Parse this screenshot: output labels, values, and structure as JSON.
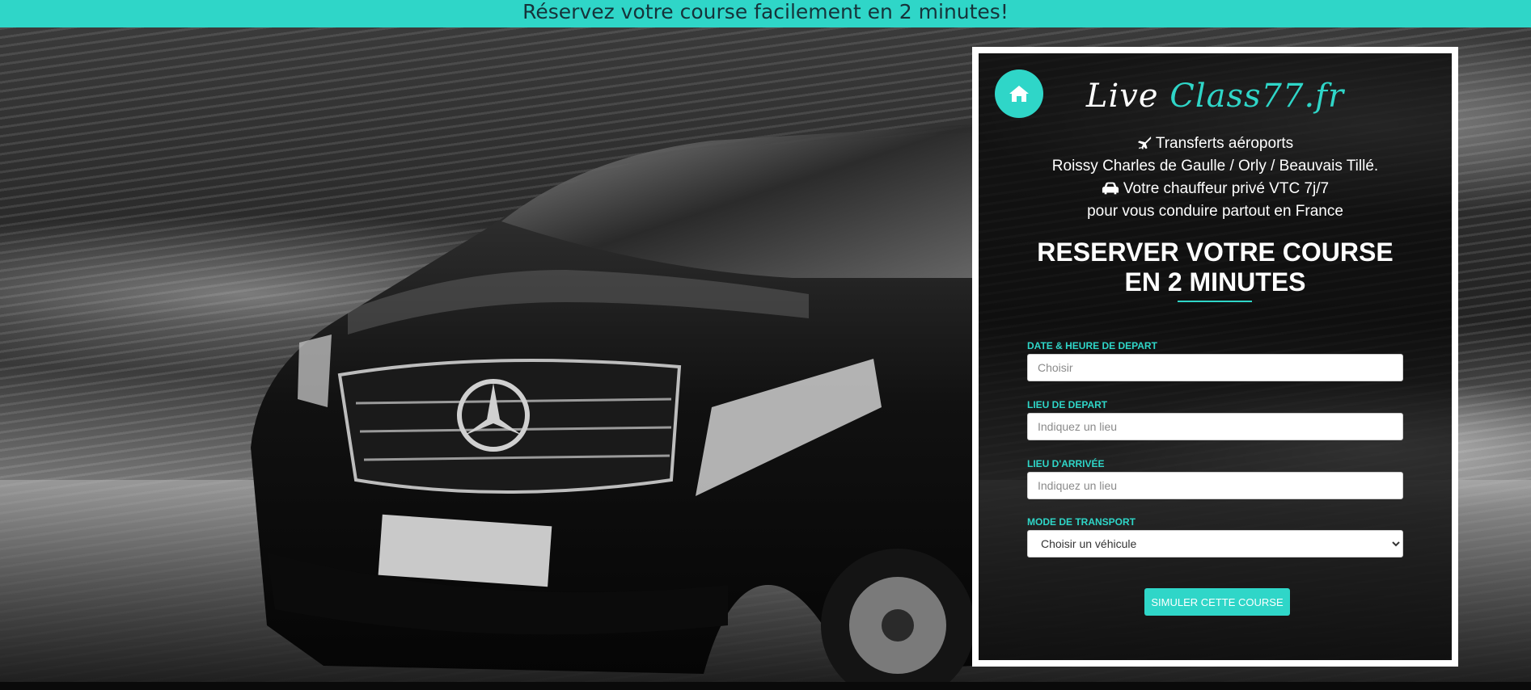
{
  "banner": {
    "text": "Réservez votre course facilement en 2 minutes!"
  },
  "brand": {
    "logo_part1": "Live",
    "logo_part2": "Class77.fr"
  },
  "intro": {
    "line1": "Transferts aéroports",
    "line2": "Roissy Charles de Gaulle / Orly / Beauvais Tillé.",
    "line3": "Votre chauffeur privé VTC 7j/7",
    "line4": "pour vous conduire partout en France"
  },
  "booking": {
    "heading_line1": "RESERVER VOTRE COURSE",
    "heading_line2": "EN 2 MINUTES",
    "fields": {
      "datetime": {
        "label": "DATE & HEURE DE DEPART",
        "placeholder": "Choisir"
      },
      "departure": {
        "label": "LIEU DE DEPART",
        "placeholder": "Indiquez un lieu"
      },
      "arrival": {
        "label": "LIEU D'ARRIVÉE",
        "placeholder": "Indiquez un lieu"
      },
      "transport": {
        "label": "MODE DE TRANSPORT",
        "selected": "Choisir un véhicule"
      }
    },
    "submit_label": "SIMULER CETTE COURSE"
  },
  "icons": {
    "home": "home-icon",
    "plane": "plane-icon",
    "car": "car-icon"
  },
  "colors": {
    "accent": "#2fd6c8",
    "banner_text": "#16333a",
    "panel_border": "#ffffff"
  }
}
